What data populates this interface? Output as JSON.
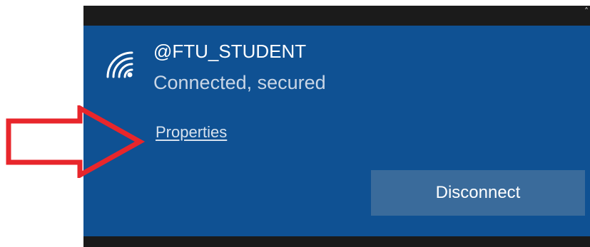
{
  "network": {
    "ssid": "@FTU_STUDENT",
    "status": "Connected, secured",
    "properties_label": "Properties",
    "disconnect_label": "Disconnect",
    "icon": "wifi-secured-icon"
  },
  "annotation": {
    "arrow_color": "#e8262b",
    "arrow_icon": "right-arrow-outline"
  },
  "colors": {
    "panel": "#0f5193",
    "button": "#3a6b9b",
    "frame": "#1a1a1a"
  }
}
